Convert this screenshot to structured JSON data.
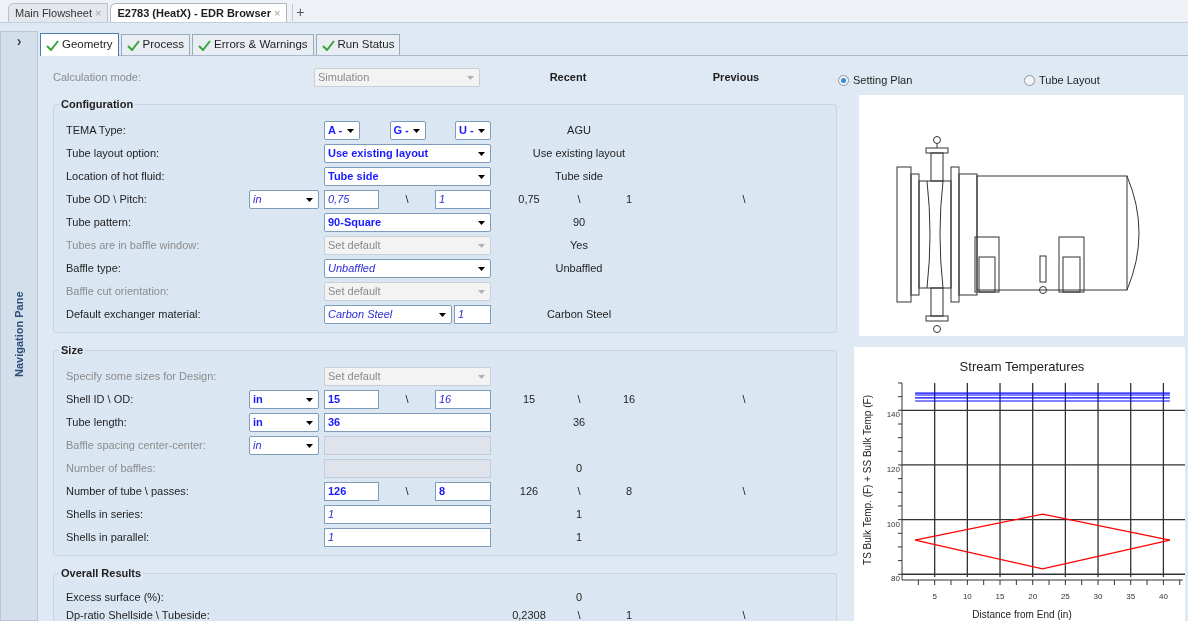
{
  "document_tabs": [
    {
      "label": "Main Flowsheet",
      "close": "×",
      "selected": false
    },
    {
      "label": "E2783 (HeatX) - EDR Browser",
      "close": "×",
      "selected": true
    }
  ],
  "new_tab_button": "+",
  "navigation_pane": {
    "expand_glyph": "›",
    "title": "Navigation Pane"
  },
  "tabs": [
    {
      "label": "Geometry",
      "selected": true
    },
    {
      "label": "Process",
      "selected": false
    },
    {
      "label": "Errors & Warnings",
      "selected": false
    },
    {
      "label": "Run Status",
      "selected": false
    }
  ],
  "calculation_mode": {
    "label": "Calculation mode:",
    "value": "Simulation",
    "disabled": true
  },
  "column_headers": {
    "recent": "Recent",
    "previous": "Previous"
  },
  "sections": [
    {
      "title": "Configuration",
      "rows": [
        {
          "label": "TEMA Type:",
          "disabled": false,
          "controls": [
            {
              "kind": "dropdown",
              "value": "A -",
              "entered": true
            },
            {
              "kind": "dropdown",
              "value": "G -",
              "entered": true
            },
            {
              "kind": "dropdown",
              "value": "U -",
              "entered": true
            }
          ],
          "recent": [
            "AGU"
          ]
        },
        {
          "label": "Tube layout option:",
          "disabled": false,
          "controls": [
            {
              "kind": "dropdown",
              "value": "Use existing layout",
              "entered": true
            }
          ],
          "recent": [
            "Use existing layout"
          ]
        },
        {
          "label": "Location of hot fluid:",
          "disabled": false,
          "controls": [
            {
              "kind": "dropdown",
              "value": "Tube side",
              "entered": true
            }
          ],
          "recent": [
            "Tube side"
          ]
        },
        {
          "label": "Tube OD \\ Pitch:",
          "disabled": false,
          "unit": {
            "value": "in",
            "entered": false
          },
          "controls": [
            {
              "kind": "input",
              "value": "0,75",
              "entered": false
            },
            {
              "kind": "input",
              "value": "1",
              "entered": false
            }
          ],
          "separator": "\\",
          "recent": [
            "0,75",
            "\\",
            "1"
          ],
          "previous": [
            "\\"
          ]
        },
        {
          "label": "Tube pattern:",
          "disabled": false,
          "controls": [
            {
              "kind": "dropdown",
              "value": "90-Square",
              "entered": true
            }
          ],
          "recent": [
            "90"
          ]
        },
        {
          "label": "Tubes are in baffle window:",
          "disabled": true,
          "controls": [
            {
              "kind": "dropdown",
              "value": "Set default",
              "disabled": true
            }
          ],
          "recent": [
            "Yes"
          ]
        },
        {
          "label": "Baffle type:",
          "disabled": false,
          "controls": [
            {
              "kind": "dropdown",
              "value": "Unbaffled",
              "entered": false
            }
          ],
          "recent": [
            "Unbaffled"
          ]
        },
        {
          "label": "Baffle cut orientation:",
          "disabled": true,
          "controls": [
            {
              "kind": "dropdown",
              "value": "Set default",
              "disabled": true
            }
          ]
        },
        {
          "label": "Default exchanger material:",
          "disabled": false,
          "controls": [
            {
              "kind": "dropdown",
              "value": "Carbon Steel",
              "entered": false
            },
            {
              "kind": "input",
              "value": "1",
              "entered": false
            }
          ],
          "recent": [
            "Carbon Steel"
          ]
        }
      ]
    },
    {
      "title": "Size",
      "rows": [
        {
          "label": "Specify some sizes for Design:",
          "disabled": true,
          "controls": [
            {
              "kind": "dropdown",
              "value": "Set default",
              "disabled": true
            }
          ]
        },
        {
          "label": "Shell ID \\ OD:",
          "disabled": false,
          "unit": {
            "value": "in",
            "entered": true
          },
          "controls": [
            {
              "kind": "input",
              "value": "15",
              "entered": true
            },
            {
              "kind": "input",
              "value": "16",
              "entered": false
            }
          ],
          "separator": "\\",
          "recent": [
            "15",
            "\\",
            "16"
          ],
          "previous": [
            "\\"
          ]
        },
        {
          "label": "Tube length:",
          "disabled": false,
          "unit": {
            "value": "in",
            "entered": true
          },
          "controls": [
            {
              "kind": "input",
              "value": "36",
              "entered": true
            }
          ],
          "recent": [
            "36"
          ]
        },
        {
          "label": "Baffle spacing center-center:",
          "disabled": true,
          "unit": {
            "value": "in",
            "entered": false
          },
          "controls": [
            {
              "kind": "input",
              "disabled": true
            }
          ]
        },
        {
          "label": "Number of baffles:",
          "disabled": true,
          "controls": [
            {
              "kind": "input",
              "disabled": true
            }
          ],
          "recent": [
            "0"
          ]
        },
        {
          "label": "Number of tube \\ passes:",
          "disabled": false,
          "controls": [
            {
              "kind": "input",
              "value": "126",
              "entered": true
            },
            {
              "kind": "input",
              "value": "8",
              "entered": true
            }
          ],
          "separator": "\\",
          "recent": [
            "126",
            "\\",
            "8"
          ],
          "previous": [
            "\\"
          ]
        },
        {
          "label": "Shells in series:",
          "disabled": false,
          "controls": [
            {
              "kind": "input",
              "value": "1",
              "entered": false
            }
          ],
          "recent": [
            "1"
          ]
        },
        {
          "label": "Shells in parallel:",
          "disabled": false,
          "controls": [
            {
              "kind": "input",
              "value": "1",
              "entered": false
            }
          ],
          "recent": [
            "1"
          ]
        }
      ]
    },
    {
      "title": "Overall Results",
      "rows": [
        {
          "label": "Excess surface (%):",
          "disabled": false,
          "recent": [
            "0"
          ]
        },
        {
          "label": "Dp-ratio Shellside \\ Tubeside:",
          "disabled": false,
          "recent": [
            "0,2308",
            "\\",
            "1"
          ],
          "previous": [
            "\\"
          ]
        }
      ]
    }
  ],
  "view_options": [
    {
      "label": "Setting Plan",
      "selected": true
    },
    {
      "label": "Tube Layout",
      "selected": false
    }
  ],
  "chart_data": {
    "type": "line",
    "title": "Stream Temperatures",
    "xlabel": "Distance from End (in)",
    "ylabel": "TS Bulk Temp. (F) + SS Bulk Temp (F)",
    "x": [
      2,
      21.5,
      41
    ],
    "series": [
      {
        "color": "#0000ff",
        "values": [
          146.3,
          146.3,
          146.3
        ]
      },
      {
        "color": "#0000ff",
        "values": [
          145.6,
          145.6,
          145.6
        ]
      },
      {
        "color": "#0000ff",
        "values": [
          144.6,
          144.6,
          144.6
        ]
      },
      {
        "color": "#0000ff",
        "values": [
          143.4,
          143.4,
          143.4
        ]
      },
      {
        "color": "#ff0000",
        "values": [
          92.5,
          102,
          92.5
        ]
      },
      {
        "color": "#ff0000",
        "values": [
          92.5,
          82,
          92.5
        ]
      }
    ],
    "xlim": [
      0,
      43
    ],
    "ylim": [
      79,
      150
    ],
    "grid": true,
    "xticks": [
      5,
      10,
      15,
      20,
      25,
      30,
      35,
      40
    ],
    "yticks": [
      80,
      100,
      120,
      140
    ]
  }
}
